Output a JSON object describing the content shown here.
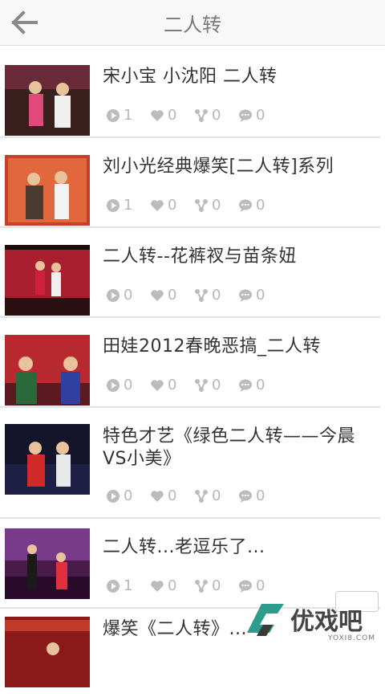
{
  "header": {
    "title": "二人转",
    "back_icon": "arrow-left-icon"
  },
  "items": [
    {
      "title": "宋小宝 小沈阳 二人转",
      "plays": "1",
      "likes": "0",
      "shares": "0",
      "comments": "0"
    },
    {
      "title": "刘小光经典爆笑[二人转]系列",
      "plays": "1",
      "likes": "0",
      "shares": "0",
      "comments": "0"
    },
    {
      "title": "二人转--花裤衩与苗条妞",
      "plays": "0",
      "likes": "0",
      "shares": "0",
      "comments": "0"
    },
    {
      "title": "田娃2012春晚恶搞_二人转",
      "plays": "0",
      "likes": "0",
      "shares": "0",
      "comments": "0"
    },
    {
      "title": "特色才艺《绿色二人转——今晨VS小美》",
      "plays": "0",
      "likes": "0",
      "shares": "0",
      "comments": "0"
    },
    {
      "title": "二人转...老逗乐了...",
      "plays": "1",
      "likes": "0",
      "shares": "0",
      "comments": "0"
    },
    {
      "title": "爆笑《二人转》..."
    }
  ],
  "watermark": {
    "text": "优戏吧",
    "sub": "YOXI8.COM"
  }
}
